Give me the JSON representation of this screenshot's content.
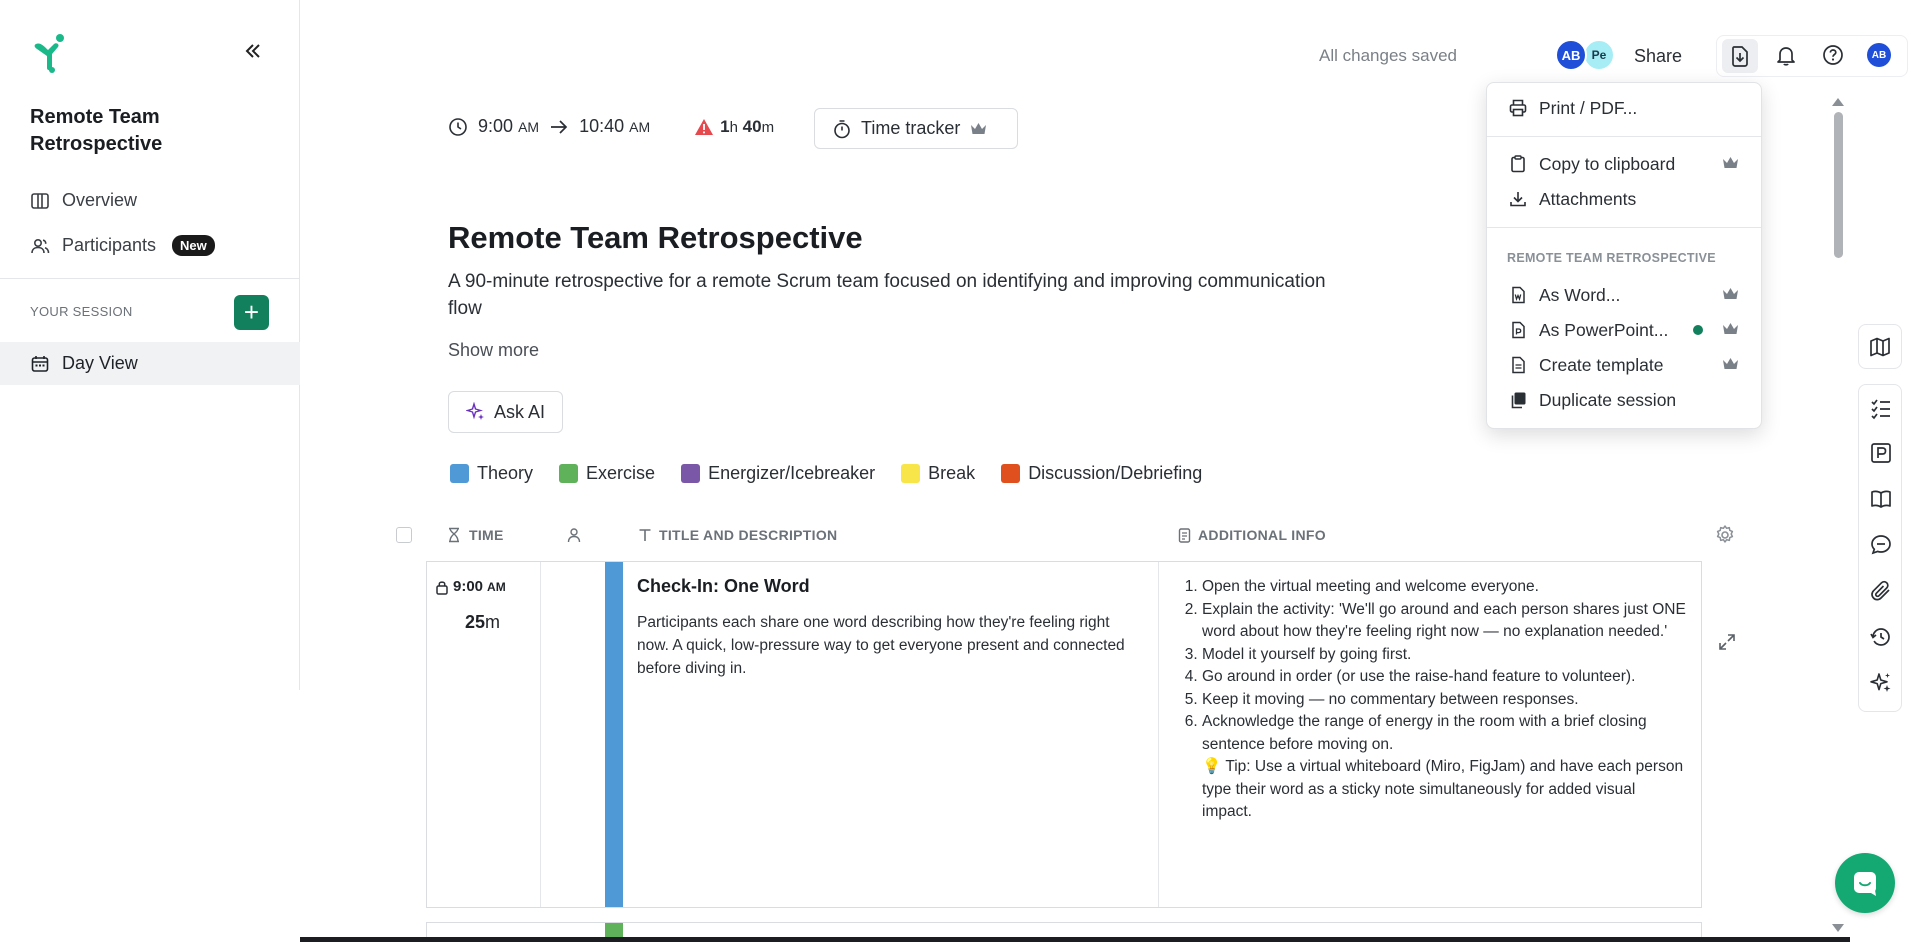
{
  "sidebar": {
    "session_title": "Remote Team Retrospective",
    "nav": [
      {
        "label": "Overview",
        "icon": "columns-icon"
      },
      {
        "label": "Participants",
        "icon": "users-icon",
        "badge": "New"
      }
    ],
    "section_label": "YOUR SESSION",
    "add_label": "+",
    "day_view_label": "Day View"
  },
  "header": {
    "saved_status": "All changes saved",
    "avatars": [
      "AB",
      "Pe"
    ],
    "share_label": "Share",
    "user_initials": "AB"
  },
  "session": {
    "start_time": "9:00",
    "start_ampm": "AM",
    "end_time": "10:40",
    "end_ampm": "AM",
    "duration_h": "1",
    "duration_h_unit": "h",
    "duration_m": "40",
    "duration_m_unit": "m",
    "time_tracker_label": "Time tracker",
    "title": "Remote Team Retrospective",
    "description": "A 90-minute retrospective for a remote Scrum team focused on identifying and improving communication flow",
    "show_more_label": "Show more",
    "ask_ai_label": "Ask AI"
  },
  "legend": [
    {
      "label": "Theory",
      "color": "#4f9ad6"
    },
    {
      "label": "Exercise",
      "color": "#5fb15a"
    },
    {
      "label": "Energizer/Icebreaker",
      "color": "#7b57a8"
    },
    {
      "label": "Break",
      "color": "#f7e54a"
    },
    {
      "label": "Discussion/Debriefing",
      "color": "#e0501f"
    }
  ],
  "table": {
    "headers": {
      "time": "TIME",
      "title": "TITLE AND DESCRIPTION",
      "info": "ADDITIONAL INFO"
    },
    "rows": [
      {
        "start": "9:00",
        "start_ampm": "AM",
        "length": "25",
        "length_unit": "m",
        "title": "Check-In: One Word",
        "description": "Participants each share one word describing how they're feeling right now. A quick, low-pressure way to get everyone present and connected before diving in.",
        "steps": [
          "Open the virtual meeting and welcome everyone.",
          "Explain the activity: 'We'll go around and each person shares just ONE word about how they're feeling right now — no explanation needed.'",
          "Model it yourself by going first.",
          "Go around in order (or use the raise-hand feature to volunteer).",
          "Keep it moving — no commentary between responses.",
          "Acknowledge the range of energy in the room with a brief closing sentence before moving on."
        ],
        "tip": "💡 Tip: Use a virtual whiteboard (Miro, FigJam) and have each person type their word as a sticky note simultaneously for added visual impact."
      }
    ]
  },
  "export_menu": {
    "print": "Print / PDF...",
    "copy": "Copy to clipboard",
    "attachments": "Attachments",
    "section_label": "REMOTE TEAM RETROSPECTIVE",
    "word": "As Word...",
    "powerpoint": "As PowerPoint...",
    "template": "Create template",
    "duplicate": "Duplicate session"
  },
  "colors": {
    "brand": "#12805c",
    "chat": "#14a873",
    "avatar_blue": "#1f4fd8",
    "avatar_cyan": "#a6edf5"
  }
}
